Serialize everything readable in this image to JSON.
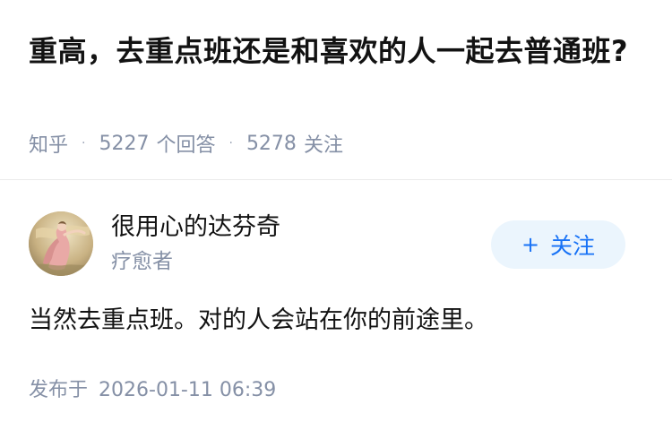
{
  "question": {
    "title": "重高，去重点班还是和喜欢的人一起去普通班?",
    "source": "知乎",
    "answer_count": "5227",
    "answer_label": "个回答",
    "follower_count": "5278",
    "follower_label": "关注",
    "separator": "·"
  },
  "author": {
    "name": "很用心的达芬奇",
    "headline": "疗愈者",
    "avatar_icon": "avatar-painting-icon",
    "follow_plus": "+",
    "follow_label": "关注"
  },
  "answer": {
    "content": "当然去重点班。对的人会站在你的前途里。",
    "publish_label": "发布于",
    "publish_time": "2026-01-11 06:39"
  },
  "colors": {
    "text_primary": "#121212",
    "text_secondary": "#8590a6",
    "accent": "#1772f6",
    "follow_bg": "#ebf5fd",
    "divider": "#ebebeb"
  }
}
